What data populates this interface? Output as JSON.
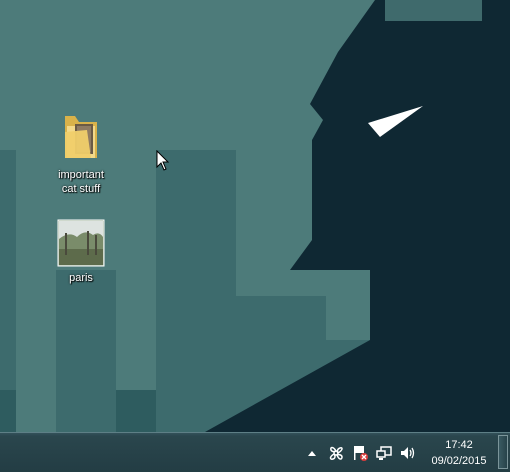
{
  "desktop": {
    "icons": [
      {
        "label": "important\ncat stuff",
        "icon": "folder-icon"
      },
      {
        "label": "paris",
        "icon": "photo-thumbnail-icon"
      }
    ]
  },
  "taskbar": {
    "tray": {
      "icons": [
        "show-hidden-icons-arrow-icon",
        "network-share-icon",
        "action-center-flag-icon",
        "network-icon",
        "volume-icon"
      ],
      "time": "17:42",
      "date": "09/02/2015"
    }
  },
  "colors": {
    "wallpaper_bg": "#4d7b7a",
    "wallpaper_mid": "#3f6a6c",
    "wallpaper_dark": "#2d5a5d",
    "silhouette": "#0f2833",
    "taskbar": "#2a464d"
  }
}
